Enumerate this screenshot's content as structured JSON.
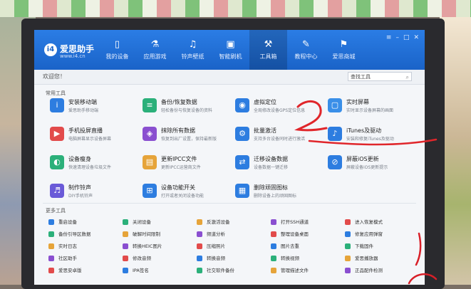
{
  "app": {
    "name": "爱思助手",
    "url": "www.i4.cn",
    "logo_text": "i4"
  },
  "nav": [
    {
      "label": "我的设备",
      "icon": "phone-icon",
      "glyph": "▯"
    },
    {
      "label": "应用游戏",
      "icon": "apps-icon",
      "glyph": "⚗"
    },
    {
      "label": "铃声壁纸",
      "icon": "bell-icon",
      "glyph": "♫"
    },
    {
      "label": "智能刷机",
      "icon": "box-icon",
      "glyph": "▣"
    },
    {
      "label": "工具箱",
      "icon": "toolbox-icon",
      "glyph": "⚒"
    },
    {
      "label": "教程中心",
      "icon": "book-icon",
      "glyph": "✎"
    },
    {
      "label": "爱思商城",
      "icon": "shop-icon",
      "glyph": "⚑"
    }
  ],
  "toolbar": {
    "welcome": "欢迎您！",
    "search_placeholder": "查找工具"
  },
  "sections": {
    "common": "常用工具",
    "more": "更多工具"
  },
  "tools": [
    {
      "name": "安装移动端",
      "desc": "爱思助手移动端",
      "color": "#2d7de0",
      "glyph": "i"
    },
    {
      "name": "备份/恢复数据",
      "desc": "轻松备份与恢复设备的资料",
      "color": "#2bb07a",
      "glyph": "≡"
    },
    {
      "name": "虚拟定位",
      "desc": "全局修改设备GPS定位信息",
      "color": "#2d7de0",
      "glyph": "◉"
    },
    {
      "name": "实时屏幕",
      "desc": "实时显示设备屏幕的画面",
      "color": "#3a8fe8",
      "glyph": "▢"
    },
    {
      "name": "手机投屏直播",
      "desc": "电脑屏幕显示设备屏幕",
      "color": "#e24b4b",
      "glyph": "▶"
    },
    {
      "name": "抹除所有数据",
      "desc": "恢复到出厂设置，保持最新版",
      "color": "#8a4fd0",
      "glyph": "◈"
    },
    {
      "name": "批量激活",
      "desc": "支持多台设备同时进行激活",
      "color": "#2d7de0",
      "glyph": "⚙"
    },
    {
      "name": "iTunes及驱动",
      "desc": "安装和修复iTunes及驱动",
      "color": "#2d7de0",
      "glyph": "♪"
    },
    {
      "name": "设备瘦身",
      "desc": "快速清理设备垃圾文件",
      "color": "#2bb07a",
      "glyph": "◐"
    },
    {
      "name": "更新IPCC文件",
      "desc": "更新IPCC运营商文件",
      "color": "#e6a43a",
      "glyph": "▤"
    },
    {
      "name": "迁移设备数据",
      "desc": "设备数据一键迁移",
      "color": "#2d7de0",
      "glyph": "⇄"
    },
    {
      "name": "屏蔽iOS更新",
      "desc": "屏蔽设备iOS更新提示",
      "color": "#2d7de0",
      "glyph": "⊘"
    },
    {
      "name": "制作铃声",
      "desc": "DIY手机铃声",
      "color": "#6a5ad8",
      "glyph": "♬"
    },
    {
      "name": "设备功能开关",
      "desc": "打开或者关闭设备功能",
      "color": "#2d7de0",
      "glyph": "⊞"
    },
    {
      "name": "删除顽固图标",
      "desc": "删除设备上的顽固图标",
      "color": "#2d7de0",
      "glyph": "▦"
    }
  ],
  "more_tools": [
    [
      "重启设备",
      "关闭设备",
      "反激活设备",
      "打开SSH通道",
      "进入恢复模式"
    ],
    [
      "备份引导区数据",
      "破解时间限制",
      "频道分析",
      "整理设备桌面",
      "修复应用弹窗"
    ],
    [
      "实时日志",
      "转换HEIC图片",
      "压缩照片",
      "图片去重",
      "下载固件"
    ],
    [
      "社区助手",
      "修改音频",
      "转换音频",
      "转换视频",
      "爱思播放器"
    ],
    [
      "爱思安卓版",
      "IPA签名",
      "社交软件备份",
      "管理描述文件",
      "正品配件检测"
    ]
  ],
  "colors": {
    "accent": "#1a63c8",
    "scribble": "#e0262b"
  }
}
